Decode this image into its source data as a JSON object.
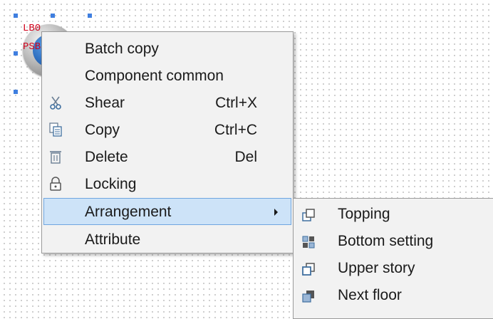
{
  "canvas": {
    "widget": {
      "label_line1": "LB0",
      "label_line2": "PSB"
    }
  },
  "context_menu": {
    "items": [
      {
        "label": "Batch copy",
        "icon": "",
        "shortcut": ""
      },
      {
        "label": "Component common",
        "icon": "",
        "shortcut": ""
      },
      {
        "label": "Shear",
        "icon": "scissors-icon",
        "shortcut": "Ctrl+X"
      },
      {
        "label": "Copy",
        "icon": "copy-icon",
        "shortcut": "Ctrl+C"
      },
      {
        "label": "Delete",
        "icon": "trash-icon",
        "shortcut": "Del"
      },
      {
        "label": "Locking",
        "icon": "lock-icon",
        "shortcut": ""
      },
      {
        "label": "Arrangement",
        "icon": "",
        "shortcut": "",
        "has_submenu": true,
        "highlighted": true
      },
      {
        "label": "Attribute",
        "icon": "",
        "shortcut": ""
      }
    ]
  },
  "submenu": {
    "items": [
      {
        "label": "Topping",
        "icon": "bring-to-front-icon"
      },
      {
        "label": "Bottom setting",
        "icon": "send-to-back-icon"
      },
      {
        "label": "Upper story",
        "icon": "bring-forward-icon"
      },
      {
        "label": "Next floor",
        "icon": "send-backward-icon"
      }
    ]
  },
  "colors": {
    "highlight_fill": "#cde3f8",
    "highlight_border": "#6fa6e0",
    "selection_handle": "#3f7fe0",
    "widget_label": "#d0021b"
  }
}
